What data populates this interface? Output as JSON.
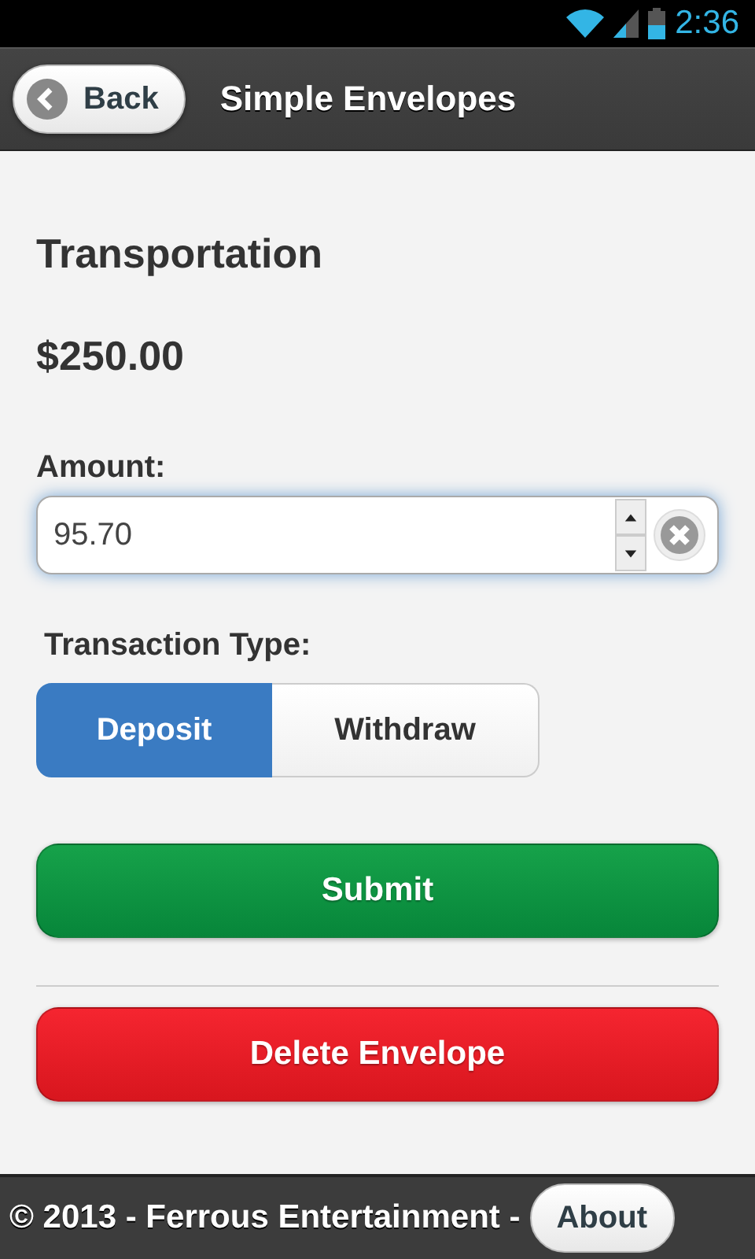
{
  "status_bar": {
    "time": "2:36"
  },
  "header": {
    "back_label": "Back",
    "title": "Simple Envelopes"
  },
  "envelope": {
    "name": "Transportation",
    "balance": "$250.00"
  },
  "amount": {
    "label": "Amount:",
    "value": "95.70"
  },
  "transaction_type": {
    "label": "Transaction Type:",
    "options": [
      {
        "label": "Deposit",
        "selected": true
      },
      {
        "label": "Withdraw",
        "selected": false
      }
    ]
  },
  "buttons": [
    {
      "label": "Submit",
      "kind": "submit"
    },
    {
      "label": "Delete Envelope",
      "kind": "delete"
    }
  ],
  "footer": {
    "text": "© 2013 - Ferrous Entertainment -",
    "about_label": "About"
  }
}
